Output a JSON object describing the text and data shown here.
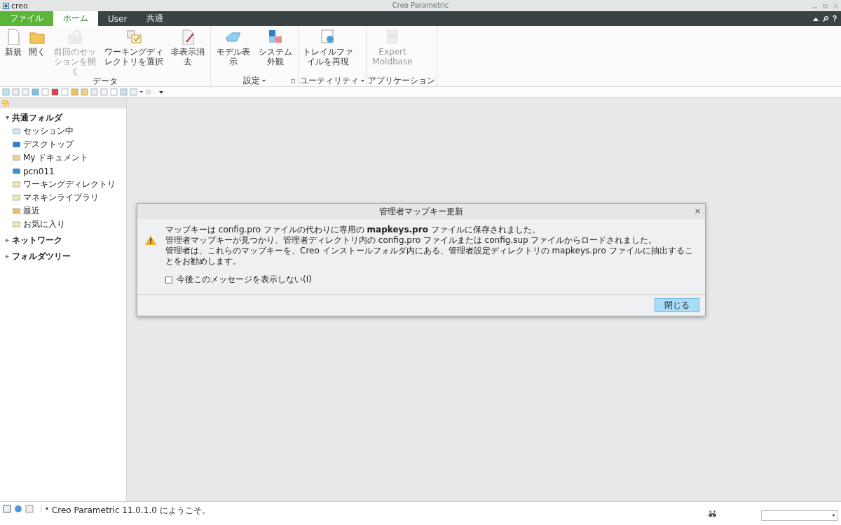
{
  "window": {
    "logo": "creo",
    "title": "Creo Parametric"
  },
  "tabs": [
    {
      "label": "ファイル",
      "kind": "file",
      "selected": false
    },
    {
      "label": "ホーム",
      "kind": "tab",
      "selected": true
    },
    {
      "label": "User",
      "kind": "tab",
      "selected": false
    },
    {
      "label": "共通",
      "kind": "tab",
      "selected": false
    }
  ],
  "ribbon": [
    {
      "label": "データ",
      "dropdown": false,
      "launcher": false,
      "buttons": [
        {
          "label": "新規",
          "disabled": false
        },
        {
          "label": "開く",
          "disabled": false
        },
        {
          "label": "前回のセッションを開く",
          "disabled": true
        },
        {
          "label": "ワーキングディレクトリを選択",
          "disabled": false
        },
        {
          "label": "非表示消去",
          "disabled": false
        }
      ]
    },
    {
      "label": "設定",
      "dropdown": true,
      "launcher": true,
      "buttons": [
        {
          "label": "モデル表示",
          "disabled": false
        },
        {
          "label": "システム外観",
          "disabled": false
        }
      ]
    },
    {
      "label": "ユーティリティ",
      "dropdown": true,
      "launcher": false,
      "buttons": [
        {
          "label": "トレイルファイルを再現",
          "disabled": false
        }
      ]
    },
    {
      "label": "アプリケーション",
      "dropdown": false,
      "launcher": false,
      "buttons": [
        {
          "label": "Expert Moldbase",
          "disabled": true
        }
      ]
    }
  ],
  "tree": [
    {
      "label": "共通フォルダ",
      "expanded": true,
      "children": [
        {
          "label": "セッション中"
        },
        {
          "label": "デスクトップ"
        },
        {
          "label": "My ドキュメント"
        },
        {
          "label": "pcn011"
        },
        {
          "label": "ワーキングディレクトリ"
        },
        {
          "label": "マネキンライブラリ"
        },
        {
          "label": "最近"
        },
        {
          "label": "お気に入り"
        }
      ]
    },
    {
      "label": "ネットワーク",
      "expanded": false
    },
    {
      "label": "フォルダツリー",
      "expanded": false
    }
  ],
  "dialog": {
    "title": "管理者マップキー更新",
    "close": "×",
    "message": [
      "マップキーは config.pro ファイルの代わりに専用の **mapkeys.pro** ファイルに保存されました。",
      "管理者マップキーが見つかり、管理者ディレクトリ内の config.pro ファイルまたは config.sup ファイルからロードされました。",
      "管理者は、これらのマップキーを、Creo インストールフォルダ内にある、管理者設定ディレクトリの mapkeys.pro ファイルに抽出することをお勧めします。"
    ],
    "checkbox": {
      "label": "今後このメッセージを表示しない(I)",
      "checked": false
    },
    "button": "閉じる"
  },
  "status_bar": {
    "bullet": "•",
    "message": "Creo Parametric 11.0.1.0 にようこそ。"
  }
}
